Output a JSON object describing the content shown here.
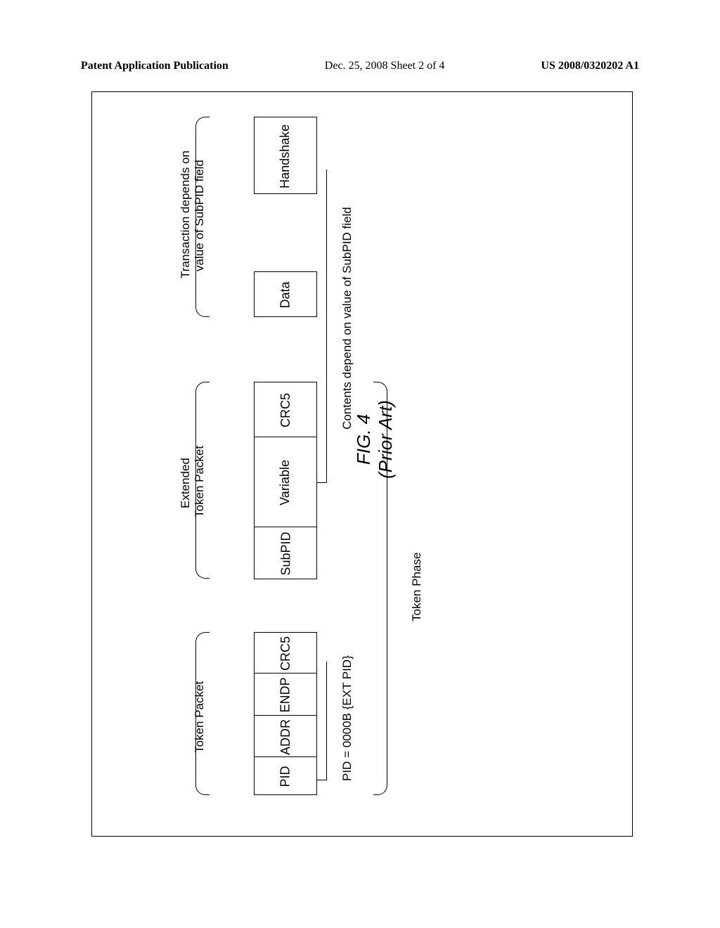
{
  "header": {
    "left": "Patent Application Publication",
    "center": "Dec. 25, 2008  Sheet 2 of 4",
    "right": "US 2008/0320202 A1"
  },
  "labels": {
    "token_packet": "Token Packet",
    "extended_token_packet_1": "Extended",
    "extended_token_packet_2": "Token Packet",
    "transaction_1": "Transaction depends on",
    "transaction_2": "value of SubPID field",
    "pid_note": "PID = 0000B {EXT PID}",
    "contents_note": "Contents depend on value of SubPID field",
    "token_phase": "Token Phase"
  },
  "cells": {
    "pid": "PID",
    "addr": "ADDR",
    "endp": "ENDP",
    "crc5_1": "CRC5",
    "subpid": "SubPID",
    "variable": "Variable",
    "crc5_2": "CRC5",
    "data": "Data",
    "handshake": "Handshake"
  },
  "figure": {
    "num": "FIG. 4",
    "note": "(Prior Art)"
  }
}
